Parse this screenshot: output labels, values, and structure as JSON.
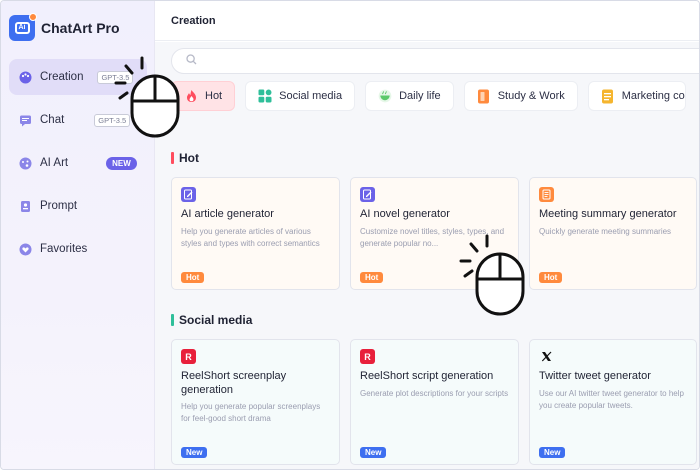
{
  "brand": {
    "name": "ChatArt Pro",
    "logo_text": "Ai"
  },
  "sidebar": {
    "items": [
      {
        "label": "Creation",
        "badge": "GPT-3.5",
        "icon": "palette-icon",
        "active": true
      },
      {
        "label": "Chat",
        "badge": "GPT-3.5",
        "icon": "chat-icon"
      },
      {
        "label": "AI Art",
        "badge": "NEW",
        "icon": "art-icon"
      },
      {
        "label": "Prompt",
        "badge": "",
        "icon": "prompt-icon"
      },
      {
        "label": "Favorites",
        "badge": "",
        "icon": "heart-icon"
      }
    ]
  },
  "header": {
    "title": "Creation"
  },
  "search": {
    "placeholder": ""
  },
  "categories": [
    {
      "label": "Hot",
      "icon": "fire-icon",
      "color": "#ff4d5e"
    },
    {
      "label": "Social media",
      "icon": "grid-icon",
      "color": "#2fbf9a"
    },
    {
      "label": "Daily life",
      "icon": "bowl-icon",
      "color": "#5cc96b"
    },
    {
      "label": "Study & Work",
      "icon": "book-icon",
      "color": "#ff8a3d"
    },
    {
      "label": "Marketing co",
      "icon": "note-icon",
      "color": "#f5b52e"
    }
  ],
  "sections": {
    "hot": {
      "title": "Hot",
      "cards": [
        {
          "title": "AI article generator",
          "desc": "Help you generate articles of various styles and types with correct semantics",
          "tag": "Hot"
        },
        {
          "title": "AI novel generator",
          "desc": "Customize novel titles, styles, types, and generate popular no...",
          "tag": "Hot"
        },
        {
          "title": "Meeting summary generator",
          "desc": "Quickly generate meeting summaries",
          "tag": "Hot"
        }
      ]
    },
    "social": {
      "title": "Social media",
      "cards": [
        {
          "title": "ReelShort screenplay generation",
          "desc": "Help you generate popular screenplays for feel-good short drama",
          "tag": "New"
        },
        {
          "title": "ReelShort script generation",
          "desc": "Generate plot descriptions for your scripts",
          "tag": "New"
        },
        {
          "title": "Twitter tweet generator",
          "desc": "Use our AI twitter tweet generator to help you create popular tweets.",
          "tag": "New"
        }
      ]
    }
  },
  "colors": {
    "accent": "#3e6ff0",
    "hot_tag": "#ff8a3d",
    "new_badge": "#6b62e8",
    "active_nav": "#e1ddf8"
  }
}
